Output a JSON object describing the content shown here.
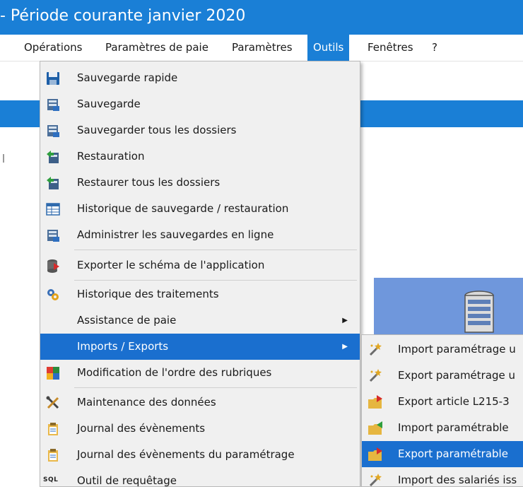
{
  "window": {
    "title": "- Période courante janvier 2020"
  },
  "menubar": {
    "items": [
      {
        "label": "Opérations"
      },
      {
        "label": "Paramètres de paie"
      },
      {
        "label": "Paramètres"
      },
      {
        "label": "Outils",
        "active": true
      },
      {
        "label": "Fenêtres"
      },
      {
        "label": "?"
      }
    ]
  },
  "outils_menu": {
    "items": [
      {
        "label": "Sauvegarde rapide",
        "icon": "floppy-disk-icon"
      },
      {
        "label": "Sauvegarde",
        "icon": "backup-icon"
      },
      {
        "label": "Sauvegarder tous les dossiers",
        "icon": "backup-all-icon"
      },
      {
        "label": "Restauration",
        "icon": "restore-icon"
      },
      {
        "label": "Restaurer tous les dossiers",
        "icon": "restore-all-icon"
      },
      {
        "label": "Historique de sauvegarde / restauration",
        "icon": "history-table-icon"
      },
      {
        "label": "Administrer les sauvegardes en ligne",
        "icon": "online-backup-icon"
      },
      {
        "label": "Exporter le schéma de l'application",
        "icon": "export-schema-icon"
      },
      {
        "label": "Historique des traitements",
        "icon": "gears-icon"
      },
      {
        "label": "Assistance de paie",
        "icon": "",
        "submenu": true
      },
      {
        "label": "Imports / Exports",
        "icon": "",
        "submenu": true,
        "highlighted": true
      },
      {
        "label": "Modification de l'ordre des rubriques",
        "icon": "color-grid-icon"
      },
      {
        "label": "Maintenance des données",
        "icon": "tools-icon"
      },
      {
        "label": "Journal des évènements",
        "icon": "journal-icon"
      },
      {
        "label": "Journal des évènements du paramétrage",
        "icon": "journal-icon"
      },
      {
        "label": "Outil de requêtage",
        "icon": "sql-icon",
        "icon_text": "SQL"
      }
    ]
  },
  "imports_exports_submenu": {
    "items": [
      {
        "label": "Import paramétrage u",
        "icon": "wand-icon"
      },
      {
        "label": "Export paramétrage u",
        "icon": "wand-icon"
      },
      {
        "label": "Export article L215-3",
        "icon": "folder-export-icon"
      },
      {
        "label": "Import paramétrable",
        "icon": "folder-import-icon"
      },
      {
        "label": "Export paramétrable",
        "icon": "folder-export-icon",
        "highlighted": true
      },
      {
        "label": "Import des salariés iss",
        "icon": "wand-icon"
      }
    ]
  },
  "colors": {
    "accent": "#1a7fd6",
    "highlight": "#1a6fcf",
    "menu_background": "#f0f0f0",
    "panel_blue": "#6f97dc"
  }
}
